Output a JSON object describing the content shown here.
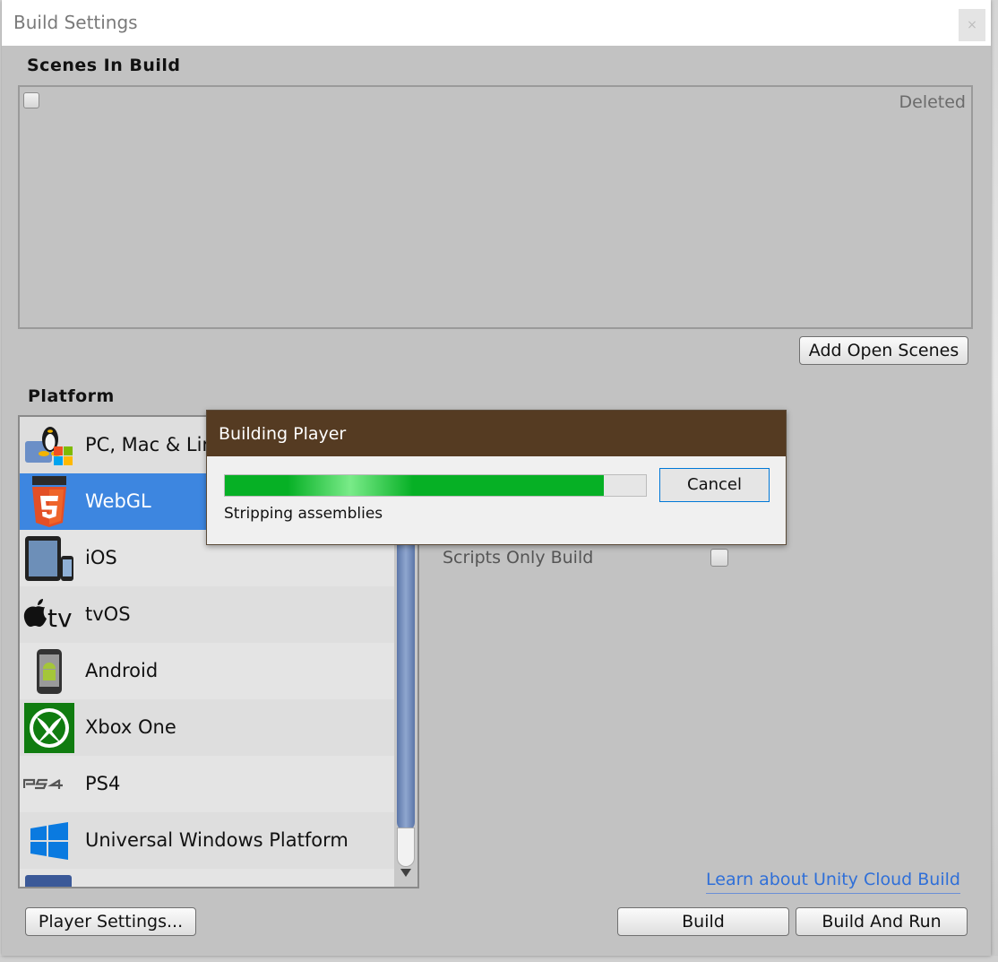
{
  "window": {
    "title": "Build Settings",
    "close_glyph": "×"
  },
  "scenes": {
    "heading": "Scenes In Build",
    "deleted_label": "Deleted",
    "add_open_scenes_label": "Add Open Scenes"
  },
  "platform": {
    "heading": "Platform",
    "items": [
      {
        "label": "PC, Mac & Linux Standalone",
        "icon": "pc-mac-linux-icon",
        "selected": false
      },
      {
        "label": "WebGL",
        "icon": "html5-icon",
        "selected": true
      },
      {
        "label": "iOS",
        "icon": "ios-device-icon",
        "selected": false
      },
      {
        "label": "tvOS",
        "icon": "apple-tv-icon",
        "selected": false
      },
      {
        "label": "Android",
        "icon": "android-phone-icon",
        "selected": false
      },
      {
        "label": "Xbox One",
        "icon": "xbox-icon",
        "selected": false
      },
      {
        "label": "PS4",
        "icon": "ps4-icon",
        "selected": false
      },
      {
        "label": "Universal Windows Platform",
        "icon": "windows-icon",
        "selected": false
      }
    ]
  },
  "options": {
    "scripts_only_build_label": "Scripts Only Build",
    "scripts_only_build_checked": false
  },
  "footer": {
    "cloud_build_link": "Learn about Unity Cloud Build",
    "player_settings_label": "Player Settings...",
    "build_label": "Build",
    "build_and_run_label": "Build And Run"
  },
  "dialog": {
    "title": "Building Player",
    "status": "Stripping assemblies",
    "progress": 0.9,
    "cancel_label": "Cancel",
    "progress_color": "#06b025",
    "title_bar_color": "#553b22"
  },
  "colors": {
    "selection": "#3d86e0",
    "link": "#2f6fd8"
  }
}
